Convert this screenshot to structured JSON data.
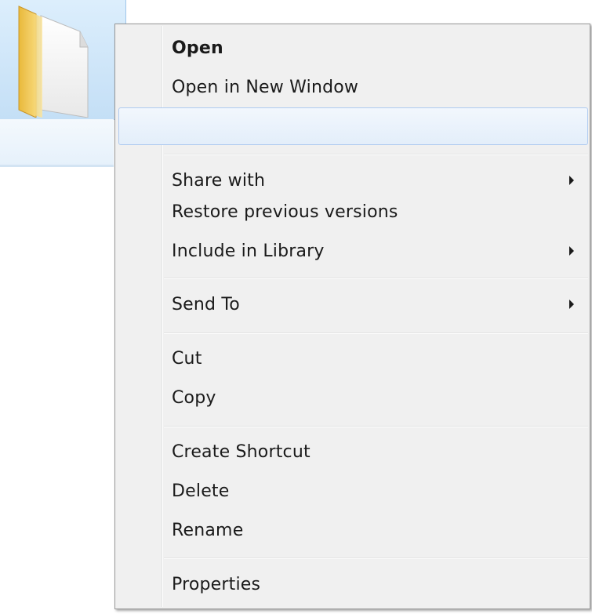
{
  "folder": {
    "icon": "folder-icon",
    "selected": true
  },
  "context_menu": {
    "items": [
      {
        "label": "Open",
        "bold": true
      },
      {
        "label": "Open in New Window"
      },
      {
        "label": "",
        "highlighted": true
      },
      {
        "label": "Share with",
        "submenu": true
      },
      {
        "label": "Restore previous versions"
      },
      {
        "label": "Include in Library",
        "submenu": true
      },
      {
        "label": "Send To",
        "submenu": true
      },
      {
        "label": "Cut"
      },
      {
        "label": "Copy"
      },
      {
        "label": "Create Shortcut"
      },
      {
        "label": "Delete"
      },
      {
        "label": "Rename"
      },
      {
        "label": "Properties"
      }
    ]
  },
  "colors": {
    "menu_background": "#f0f0f0",
    "menu_border": "#979797",
    "highlight_border": "#aecaf0",
    "selection": "#c4dff6"
  }
}
